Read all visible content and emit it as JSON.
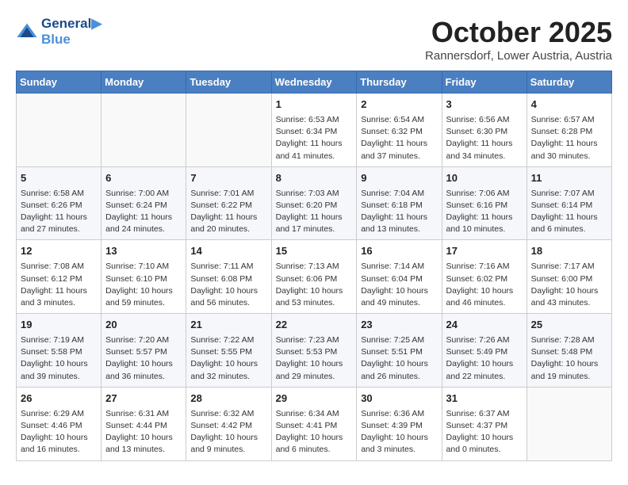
{
  "header": {
    "logo_line1": "General",
    "logo_line2": "Blue",
    "month": "October 2025",
    "location": "Rannersdorf, Lower Austria, Austria"
  },
  "weekdays": [
    "Sunday",
    "Monday",
    "Tuesday",
    "Wednesday",
    "Thursday",
    "Friday",
    "Saturday"
  ],
  "weeks": [
    [
      {
        "day": "",
        "text": ""
      },
      {
        "day": "",
        "text": ""
      },
      {
        "day": "",
        "text": ""
      },
      {
        "day": "1",
        "text": "Sunrise: 6:53 AM\nSunset: 6:34 PM\nDaylight: 11 hours\nand 41 minutes."
      },
      {
        "day": "2",
        "text": "Sunrise: 6:54 AM\nSunset: 6:32 PM\nDaylight: 11 hours\nand 37 minutes."
      },
      {
        "day": "3",
        "text": "Sunrise: 6:56 AM\nSunset: 6:30 PM\nDaylight: 11 hours\nand 34 minutes."
      },
      {
        "day": "4",
        "text": "Sunrise: 6:57 AM\nSunset: 6:28 PM\nDaylight: 11 hours\nand 30 minutes."
      }
    ],
    [
      {
        "day": "5",
        "text": "Sunrise: 6:58 AM\nSunset: 6:26 PM\nDaylight: 11 hours\nand 27 minutes."
      },
      {
        "day": "6",
        "text": "Sunrise: 7:00 AM\nSunset: 6:24 PM\nDaylight: 11 hours\nand 24 minutes."
      },
      {
        "day": "7",
        "text": "Sunrise: 7:01 AM\nSunset: 6:22 PM\nDaylight: 11 hours\nand 20 minutes."
      },
      {
        "day": "8",
        "text": "Sunrise: 7:03 AM\nSunset: 6:20 PM\nDaylight: 11 hours\nand 17 minutes."
      },
      {
        "day": "9",
        "text": "Sunrise: 7:04 AM\nSunset: 6:18 PM\nDaylight: 11 hours\nand 13 minutes."
      },
      {
        "day": "10",
        "text": "Sunrise: 7:06 AM\nSunset: 6:16 PM\nDaylight: 11 hours\nand 10 minutes."
      },
      {
        "day": "11",
        "text": "Sunrise: 7:07 AM\nSunset: 6:14 PM\nDaylight: 11 hours\nand 6 minutes."
      }
    ],
    [
      {
        "day": "12",
        "text": "Sunrise: 7:08 AM\nSunset: 6:12 PM\nDaylight: 11 hours\nand 3 minutes."
      },
      {
        "day": "13",
        "text": "Sunrise: 7:10 AM\nSunset: 6:10 PM\nDaylight: 10 hours\nand 59 minutes."
      },
      {
        "day": "14",
        "text": "Sunrise: 7:11 AM\nSunset: 6:08 PM\nDaylight: 10 hours\nand 56 minutes."
      },
      {
        "day": "15",
        "text": "Sunrise: 7:13 AM\nSunset: 6:06 PM\nDaylight: 10 hours\nand 53 minutes."
      },
      {
        "day": "16",
        "text": "Sunrise: 7:14 AM\nSunset: 6:04 PM\nDaylight: 10 hours\nand 49 minutes."
      },
      {
        "day": "17",
        "text": "Sunrise: 7:16 AM\nSunset: 6:02 PM\nDaylight: 10 hours\nand 46 minutes."
      },
      {
        "day": "18",
        "text": "Sunrise: 7:17 AM\nSunset: 6:00 PM\nDaylight: 10 hours\nand 43 minutes."
      }
    ],
    [
      {
        "day": "19",
        "text": "Sunrise: 7:19 AM\nSunset: 5:58 PM\nDaylight: 10 hours\nand 39 minutes."
      },
      {
        "day": "20",
        "text": "Sunrise: 7:20 AM\nSunset: 5:57 PM\nDaylight: 10 hours\nand 36 minutes."
      },
      {
        "day": "21",
        "text": "Sunrise: 7:22 AM\nSunset: 5:55 PM\nDaylight: 10 hours\nand 32 minutes."
      },
      {
        "day": "22",
        "text": "Sunrise: 7:23 AM\nSunset: 5:53 PM\nDaylight: 10 hours\nand 29 minutes."
      },
      {
        "day": "23",
        "text": "Sunrise: 7:25 AM\nSunset: 5:51 PM\nDaylight: 10 hours\nand 26 minutes."
      },
      {
        "day": "24",
        "text": "Sunrise: 7:26 AM\nSunset: 5:49 PM\nDaylight: 10 hours\nand 22 minutes."
      },
      {
        "day": "25",
        "text": "Sunrise: 7:28 AM\nSunset: 5:48 PM\nDaylight: 10 hours\nand 19 minutes."
      }
    ],
    [
      {
        "day": "26",
        "text": "Sunrise: 6:29 AM\nSunset: 4:46 PM\nDaylight: 10 hours\nand 16 minutes."
      },
      {
        "day": "27",
        "text": "Sunrise: 6:31 AM\nSunset: 4:44 PM\nDaylight: 10 hours\nand 13 minutes."
      },
      {
        "day": "28",
        "text": "Sunrise: 6:32 AM\nSunset: 4:42 PM\nDaylight: 10 hours\nand 9 minutes."
      },
      {
        "day": "29",
        "text": "Sunrise: 6:34 AM\nSunset: 4:41 PM\nDaylight: 10 hours\nand 6 minutes."
      },
      {
        "day": "30",
        "text": "Sunrise: 6:36 AM\nSunset: 4:39 PM\nDaylight: 10 hours\nand 3 minutes."
      },
      {
        "day": "31",
        "text": "Sunrise: 6:37 AM\nSunset: 4:37 PM\nDaylight: 10 hours\nand 0 minutes."
      },
      {
        "day": "",
        "text": ""
      }
    ]
  ]
}
